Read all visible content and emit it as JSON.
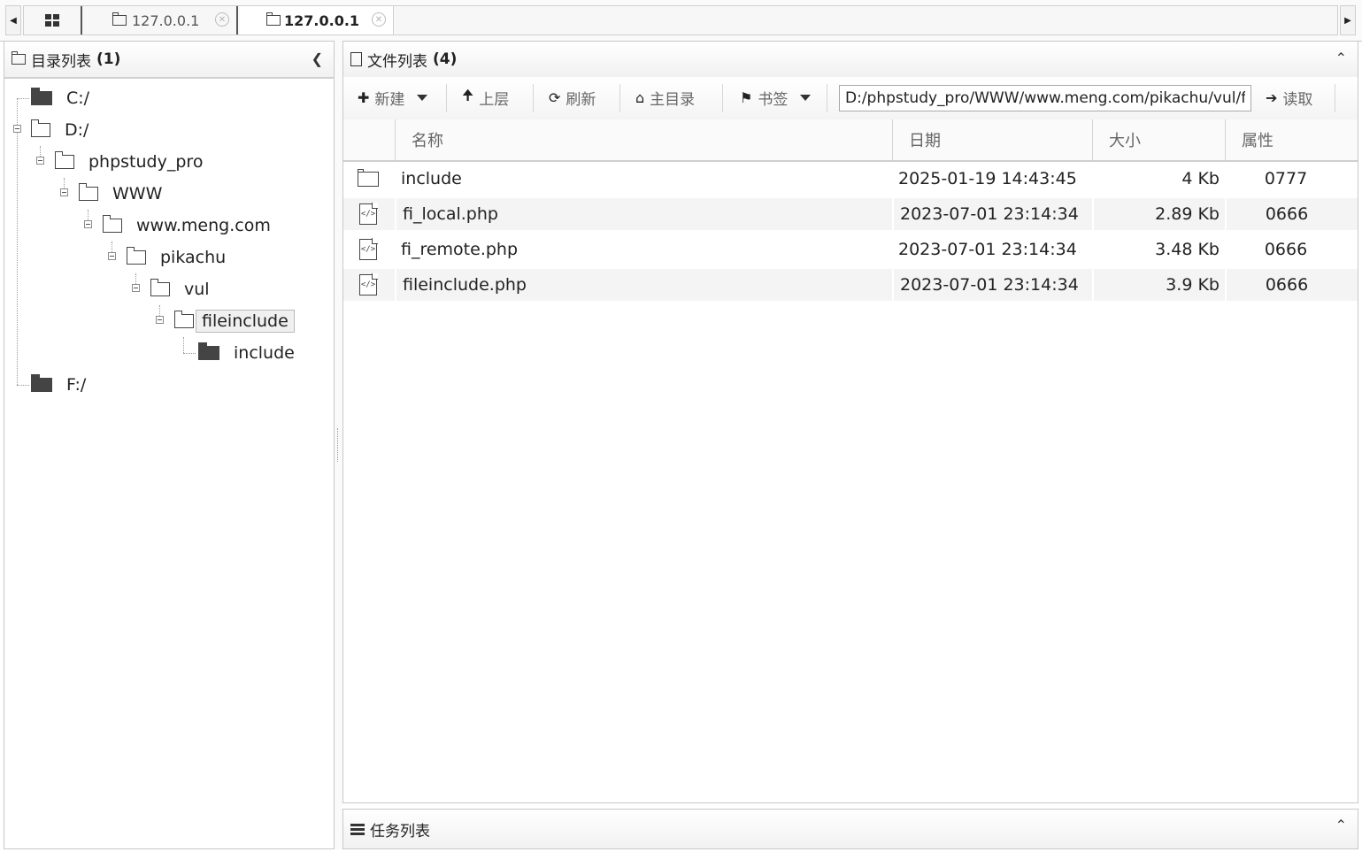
{
  "tabs": [
    {
      "label": "127.0.0.1",
      "active": false
    },
    {
      "label": "127.0.0.1",
      "active": true
    }
  ],
  "dir_panel": {
    "title": "目录列表",
    "count": "(1)",
    "tree": [
      {
        "label": "C:/"
      },
      {
        "label": "D:/"
      },
      {
        "label": "phpstudy_pro"
      },
      {
        "label": "WWW"
      },
      {
        "label": "www.meng.com"
      },
      {
        "label": "pikachu"
      },
      {
        "label": "vul"
      },
      {
        "label": "fileinclude"
      },
      {
        "label": "include"
      },
      {
        "label": "F:/"
      }
    ]
  },
  "file_panel": {
    "title": "文件列表",
    "count": "(4)",
    "toolbar": {
      "new": "新建",
      "up": "上层",
      "refresh": "刷新",
      "home": "主目录",
      "bookmark": "书签",
      "path": "D:/phpstudy_pro/WWW/www.meng.com/pikachu/vul/fileinclude/",
      "read": "读取"
    },
    "columns": {
      "name": "名称",
      "date": "日期",
      "size": "大小",
      "attr": "属性"
    },
    "rows": [
      {
        "name": "include",
        "date": "2025-01-19 14:43:45",
        "size": "4 Kb",
        "attr": "0777",
        "type": "folder-icon"
      },
      {
        "name": "fi_local.php",
        "date": "2023-07-01 23:14:34",
        "size": "2.89 Kb",
        "attr": "0666",
        "type": "code-file-icon"
      },
      {
        "name": "fi_remote.php",
        "date": "2023-07-01 23:14:34",
        "size": "3.48 Kb",
        "attr": "0666",
        "type": "code-file-icon"
      },
      {
        "name": "fileinclude.php",
        "date": "2023-07-01 23:14:34",
        "size": "3.9 Kb",
        "attr": "0666",
        "type": "code-file-icon"
      }
    ]
  },
  "task_panel": {
    "title": "任务列表"
  }
}
